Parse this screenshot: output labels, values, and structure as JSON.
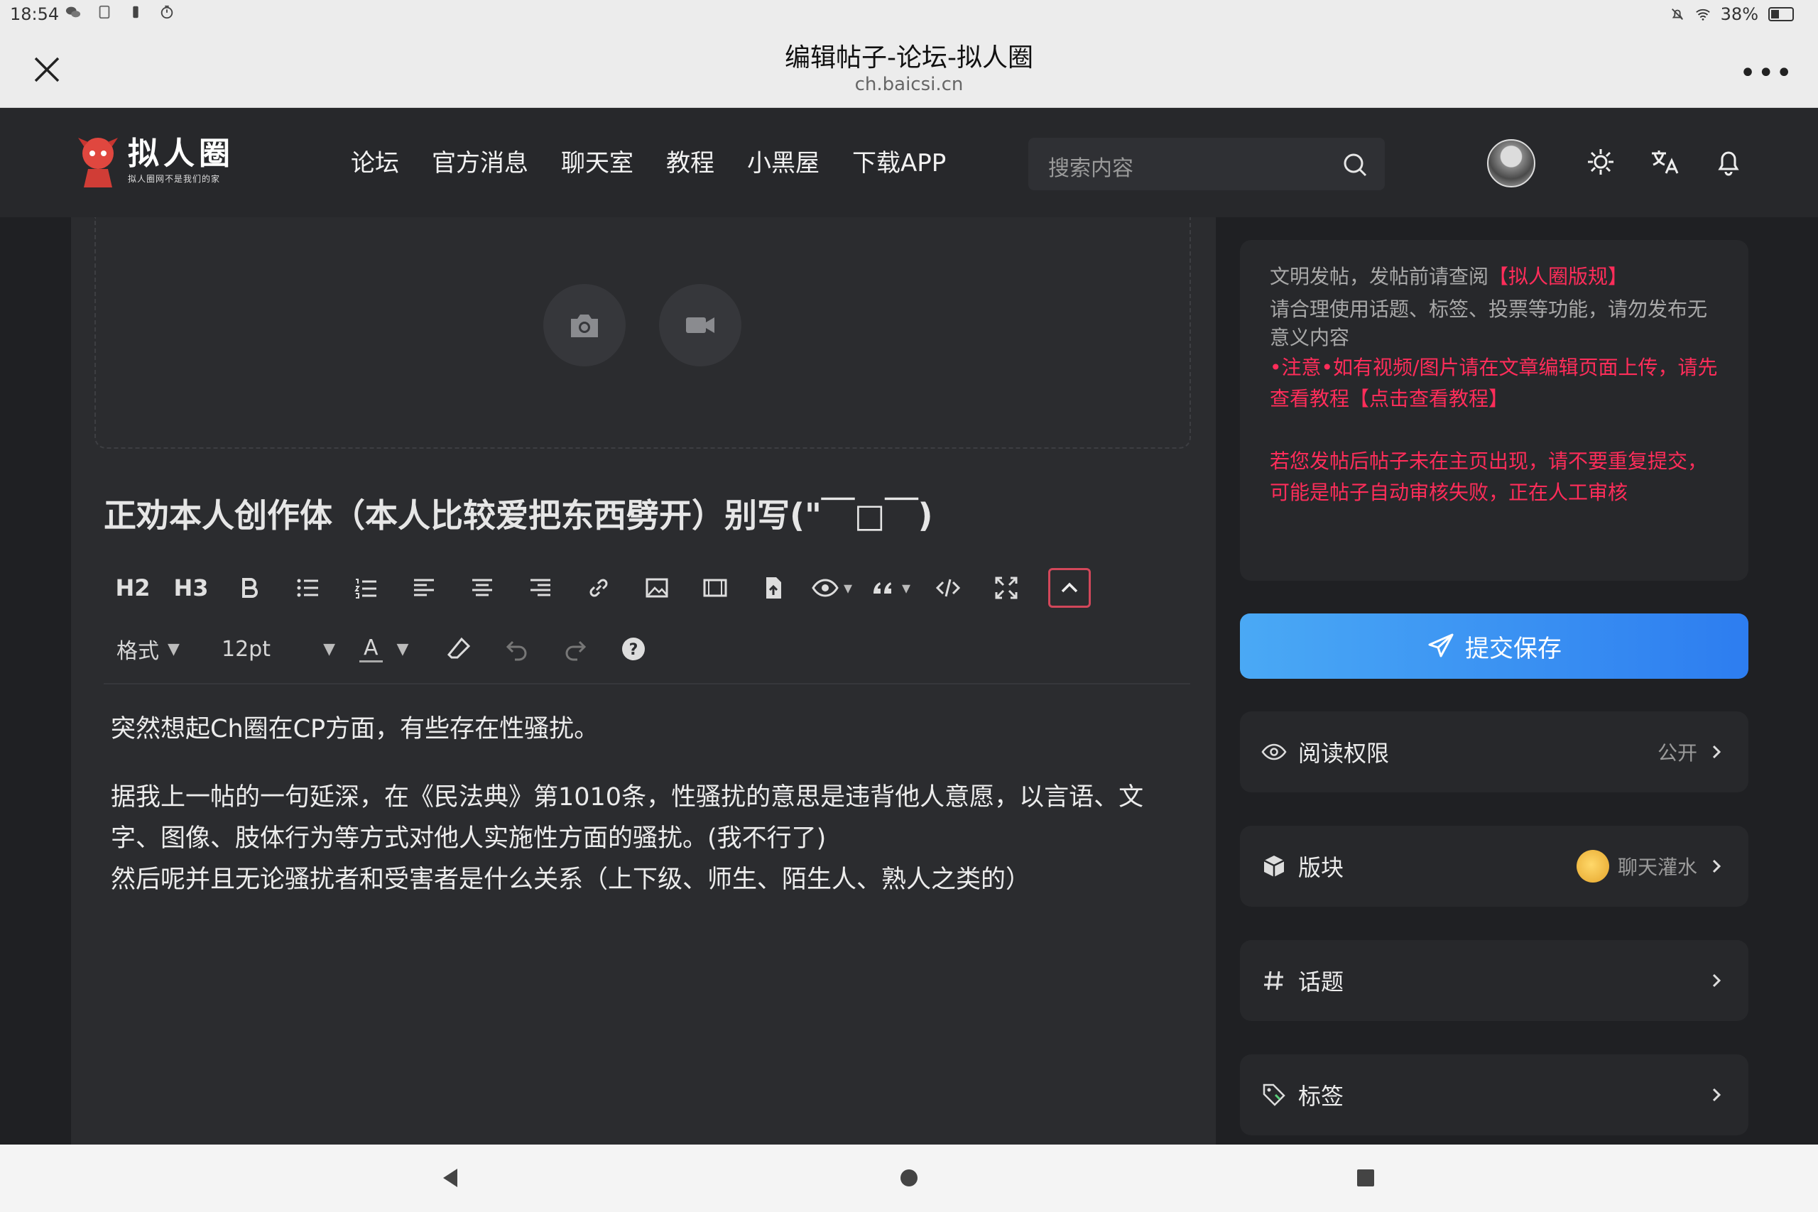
{
  "status_bar": {
    "time": "18:54",
    "battery": "38%"
  },
  "browser": {
    "title": "编辑帖子-论坛-拟人圈",
    "url": "ch.baicsi.cn"
  },
  "site": {
    "brand": "拟人圈",
    "slogan": "拟人圈网不是我们的家",
    "nav": [
      "论坛",
      "官方消息",
      "聊天室",
      "教程",
      "小黑屋",
      "下载APP"
    ],
    "search_placeholder": "搜索内容"
  },
  "editor": {
    "title": "正劝本人创作体（本人比较爱把东西劈开）别写(\"￣□￣)",
    "toolbar": [
      "H2",
      "H3"
    ],
    "format_label": "格式",
    "font_size": "12pt",
    "text_color_label": "A",
    "paragraphs": [
      "突然想起Ch圈在CP方面，有些存在性骚扰。",
      "据我上一帖的一句延深，在《民法典》第1010条，性骚扰的意思是违背他人意愿，以言语、文字、图像、肢体行为等方式对他人实施性方面的骚扰。(我不行了)",
      "然后呢并且无论骚扰者和受害者是什么关系（上下级、师生、陌生人、熟人之类的）"
    ]
  },
  "notice": {
    "line1_prefix": "文明发帖，发帖前请查阅",
    "line1_link": "【拟人圈版规】",
    "line2": "请合理使用话题、标签、投票等功能，请勿发布无意义内容",
    "line3": "•注意•如有视频/图片请在文章编辑页面上传，请先查看教程【点击查看教程】",
    "line4": "若您发帖后帖子未在主页出现，请不要重复提交，可能是帖子自动审核失败，正在人工审核"
  },
  "submit_label": "提交保存",
  "settings": [
    {
      "label": "阅读权限",
      "value": "公开"
    },
    {
      "label": "版块",
      "value": "聊天灌水"
    },
    {
      "label": "话题",
      "value": ""
    },
    {
      "label": "标签",
      "value": ""
    }
  ],
  "colors": {
    "accent_red": "#ff2d5a",
    "submit_blue": "#2d7df0",
    "bg": "#1f2023"
  }
}
